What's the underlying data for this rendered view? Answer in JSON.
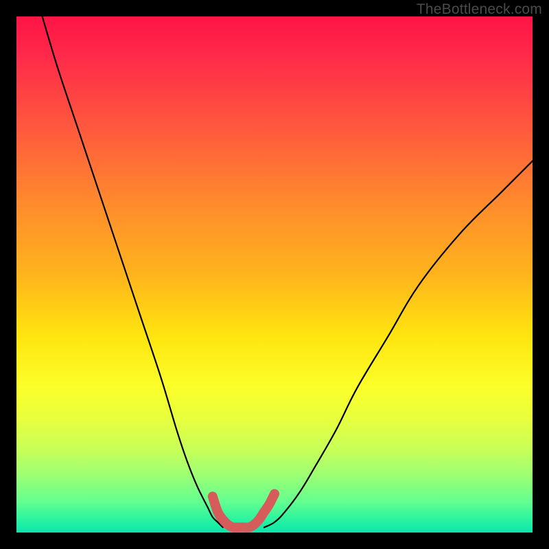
{
  "watermark": "TheBottleneck.com",
  "chart_data": {
    "type": "line",
    "title": "",
    "xlabel": "",
    "ylabel": "",
    "xlim": [
      0,
      100
    ],
    "ylim": [
      0,
      100
    ],
    "series": [
      {
        "name": "left-curve",
        "x": [
          5,
          8,
          12,
          16,
          20,
          24,
          28,
          31,
          33,
          35,
          37,
          38,
          39,
          40
        ],
        "values": [
          100,
          90,
          78,
          66,
          54,
          42,
          30,
          20,
          14,
          9,
          5,
          3,
          2,
          1
        ]
      },
      {
        "name": "right-curve",
        "x": [
          48,
          50,
          52,
          55,
          58,
          62,
          66,
          72,
          78,
          86,
          94,
          100
        ],
        "values": [
          1,
          2,
          4,
          8,
          13,
          20,
          28,
          38,
          48,
          58,
          66,
          72
        ]
      },
      {
        "name": "valley-thick",
        "x": [
          38,
          39,
          40,
          41,
          42,
          43,
          44,
          45,
          46,
          47,
          48,
          49,
          50
        ],
        "values": [
          7,
          4,
          2.5,
          1.5,
          1,
          1,
          1,
          1,
          1.5,
          2.5,
          4,
          5.5,
          7.5
        ]
      }
    ],
    "gradient_stops": [
      {
        "pos": 0.0,
        "color": "#ff1446"
      },
      {
        "pos": 0.5,
        "color": "#ffe50f"
      },
      {
        "pos": 0.8,
        "color": "#d8ff4a"
      },
      {
        "pos": 1.0,
        "color": "#0fe3ad"
      }
    ]
  }
}
